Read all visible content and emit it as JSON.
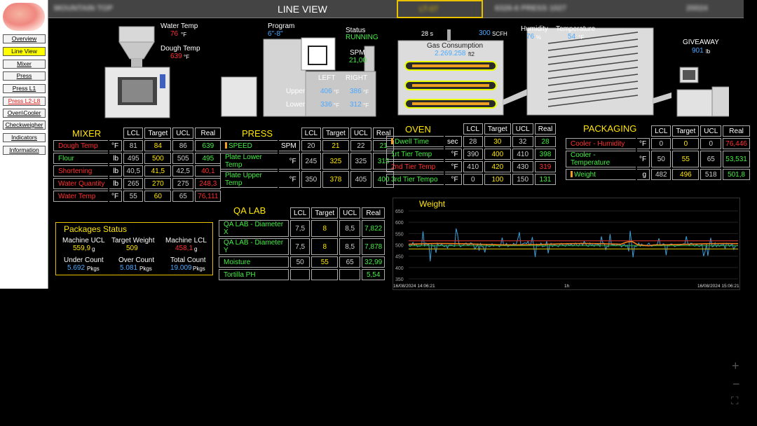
{
  "nav": [
    "Overview",
    "Line View",
    "Mixer",
    "Press",
    "Press L1",
    "Press L2-L8",
    "Oven\\Cooler",
    "Checkweigher",
    "Indicators",
    "Information"
  ],
  "topbar": {
    "site": "MOUNTAIN TOP",
    "title": "LINE VIEW",
    "shift": "LT-07",
    "product": "6326-6 PRESS 1027",
    "code": "20024"
  },
  "mixer_head": {
    "water_temp_label": "Water Temp",
    "water_temp": "76",
    "dough_temp_label": "Dough Temp",
    "dough_temp": "639",
    "unit_f": "°F"
  },
  "press_head": {
    "program_label": "Program",
    "program": "6\"-8\"",
    "status_label": "Status",
    "status": "RUNNING",
    "spm_label": "SPM",
    "spm": "21,00",
    "left": "LEFT",
    "right": "RIGHT",
    "upper": "Upper",
    "lower": "Lower",
    "upper_left": "406",
    "upper_right": "386",
    "lower_left": "336",
    "lower_right": "312"
  },
  "oven_head": {
    "time": "28 s",
    "gas_flow": "300",
    "gas_unit": "SCFH",
    "gas_label": "Gas Consumption",
    "gas_value": "2.269.258",
    "gas_unit2": "ft2",
    "humidity_label": "Humidity",
    "humidity": "76",
    "humidity_unit": "%",
    "temp_label": "Temperature",
    "temp": "54",
    "temp_unit": "°F"
  },
  "pack_head": {
    "giveaway_label": "GIVEAWAY",
    "giveaway": "901",
    "giveaway_unit": "lb"
  },
  "headers": [
    "LCL",
    "Target",
    "UCL",
    "Real"
  ],
  "mixer": {
    "title": "MIXER",
    "rows": [
      {
        "name": "Dough Temp",
        "unit": "°F",
        "lcl": "81",
        "target": "84",
        "ucl": "86",
        "real": "639",
        "alarm": true,
        "bad": false
      },
      {
        "name": "Flour",
        "unit": "lb",
        "lcl": "495",
        "target": "500",
        "ucl": "505",
        "real": "495",
        "alarm": false,
        "bad": false
      },
      {
        "name": "Shortening",
        "unit": "lb",
        "lcl": "40,5",
        "target": "41,5",
        "ucl": "42,5",
        "real": "40,1",
        "alarm": true,
        "bad": true
      },
      {
        "name": "Water Quantity",
        "unit": "lb",
        "lcl": "265",
        "target": "270",
        "ucl": "275",
        "real": "248,3",
        "alarm": true,
        "bad": true
      },
      {
        "name": "Water Temp",
        "unit": "°F",
        "lcl": "55",
        "target": "60",
        "ucl": "65",
        "real": "76,111",
        "alarm": true,
        "bad": true
      }
    ]
  },
  "press": {
    "title": "PRESS",
    "rows": [
      {
        "name": "SPEED",
        "unit": "SPM",
        "lcl": "20",
        "target": "21",
        "ucl": "22",
        "real": "21",
        "alarm": false,
        "bad": false
      },
      {
        "name": "Plate Lower Temp",
        "unit": "°F",
        "lcl": "245",
        "target": "325",
        "ucl": "325",
        "real": "315",
        "alarm": false,
        "bad": false
      },
      {
        "name": "Plate Upper Temp",
        "unit": "°F",
        "lcl": "350",
        "target": "378",
        "ucl": "405",
        "real": "400",
        "alarm": false,
        "bad": false
      }
    ]
  },
  "oven": {
    "title": "OVEN",
    "rows": [
      {
        "name": "Dwell Time",
        "unit": "sec",
        "lcl": "28",
        "target": "30",
        "ucl": "32",
        "real": "28",
        "alarm": false,
        "bad": false
      },
      {
        "name": "1rt Tier Temp",
        "unit": "°F",
        "lcl": "390",
        "target": "400",
        "ucl": "410",
        "real": "398",
        "alarm": false,
        "bad": false
      },
      {
        "name": "2nd Tier Temp",
        "unit": "°F",
        "lcl": "410",
        "target": "420",
        "ucl": "430",
        "real": "319",
        "alarm": true,
        "bad": true
      },
      {
        "name": "3rd Tier Tempo",
        "unit": "°F",
        "lcl": "0",
        "target": "100",
        "ucl": "150",
        "real": "131",
        "alarm": false,
        "bad": false
      }
    ]
  },
  "packaging": {
    "title": "PACKAGING",
    "rows": [
      {
        "name": "Cooler - Humidity",
        "unit": "°F",
        "lcl": "0",
        "target": "0",
        "ucl": "0",
        "real": "76,446",
        "alarm": true,
        "bad": true
      },
      {
        "name": "Cooler - Temperature",
        "unit": "°F",
        "lcl": "50",
        "target": "55",
        "ucl": "65",
        "real": "53,531",
        "alarm": false,
        "bad": false
      },
      {
        "name": "Weight",
        "unit": "g",
        "lcl": "482",
        "target": "496",
        "ucl": "518",
        "real": "501,8",
        "alarm": false,
        "bad": false
      }
    ]
  },
  "qalab": {
    "title": "QA LAB",
    "rows": [
      {
        "name": "QA LAB - Diameter X",
        "lcl": "7,5",
        "target": "8",
        "ucl": "8,5",
        "real": "7,822"
      },
      {
        "name": "QA LAB - Diameter Y",
        "lcl": "7,5",
        "target": "8",
        "ucl": "8,5",
        "real": "7,878"
      },
      {
        "name": "Moisture",
        "lcl": "50",
        "target": "55",
        "ucl": "65",
        "real": "32,99"
      },
      {
        "name": "Tortilla PH",
        "lcl": "",
        "target": "",
        "ucl": "",
        "real": "5,54"
      }
    ]
  },
  "packages": {
    "title": "Packages Status",
    "machine_ucl_label": "Machine UCL",
    "machine_ucl": "559,9",
    "target_weight_label": "Target Weight",
    "target_weight": "509",
    "machine_lcl_label": "Machine LCL",
    "machine_lcl": "458,1",
    "g": "g",
    "under_label": "Under Count",
    "under": "5.692",
    "over_label": "Over Count",
    "over": "5.081",
    "total_label": "Total Count",
    "total": "19.009",
    "pkgs": "Pkgs"
  },
  "chart_data": {
    "type": "line",
    "title": "Weight",
    "y_ticks": [
      "650",
      "600",
      "550",
      "500",
      "450",
      "400",
      "350"
    ],
    "ylim": [
      350,
      650
    ],
    "x_start": "16/08/2024 14:06:21",
    "x_mid": "1h",
    "x_end": "16/08/2024 15:06:21",
    "limits": {
      "ucl": 518,
      "target": 496,
      "lcl": 482
    },
    "colors": {
      "signal": "#3aa0d8",
      "avg": "#f08020",
      "ucl": "#d03030",
      "lcl": "#c8b400",
      "target": "#30b030"
    }
  }
}
